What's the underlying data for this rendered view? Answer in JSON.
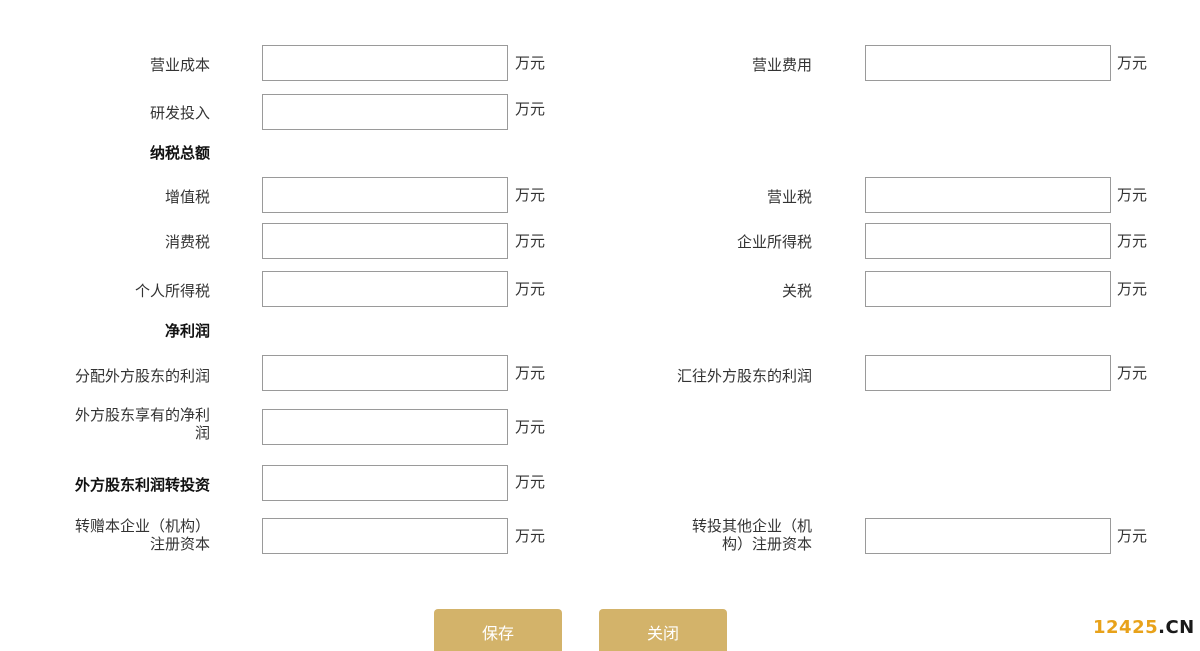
{
  "unit": "万元",
  "rows": {
    "operating_cost": "营业成本",
    "operating_expense": "营业费用",
    "rd_investment": "研发投入",
    "vat": "增值税",
    "business_tax": "营业税",
    "consumption_tax": "消费税",
    "corporate_income_tax": "企业所得税",
    "personal_income_tax": "个人所得税",
    "customs_duty": "关税",
    "profit_distributed_foreign": "分配外方股东的利润",
    "profit_remitted_foreign": "汇往外方股东的利润",
    "foreign_net_profit_line1": "外方股东享有的净利",
    "foreign_net_profit_line2": "润",
    "reinvest_to_company_line1": "转赠本企业（机构）",
    "reinvest_to_company_line2": "注册资本",
    "reinvest_other_line1": "转投其他企业（机",
    "reinvest_other_line2": "构）注册资本"
  },
  "sections": {
    "total_tax": "纳税总额",
    "net_profit": "净利润",
    "foreign_profit_reinvestment": "外方股东利润转投资"
  },
  "buttons": {
    "save": "保存",
    "close": "关闭"
  },
  "watermark": {
    "number": "12425",
    "suffix": ".CN"
  },
  "colors": {
    "button_bg": "#d3b36a",
    "watermark_number": "#e8a21a"
  }
}
